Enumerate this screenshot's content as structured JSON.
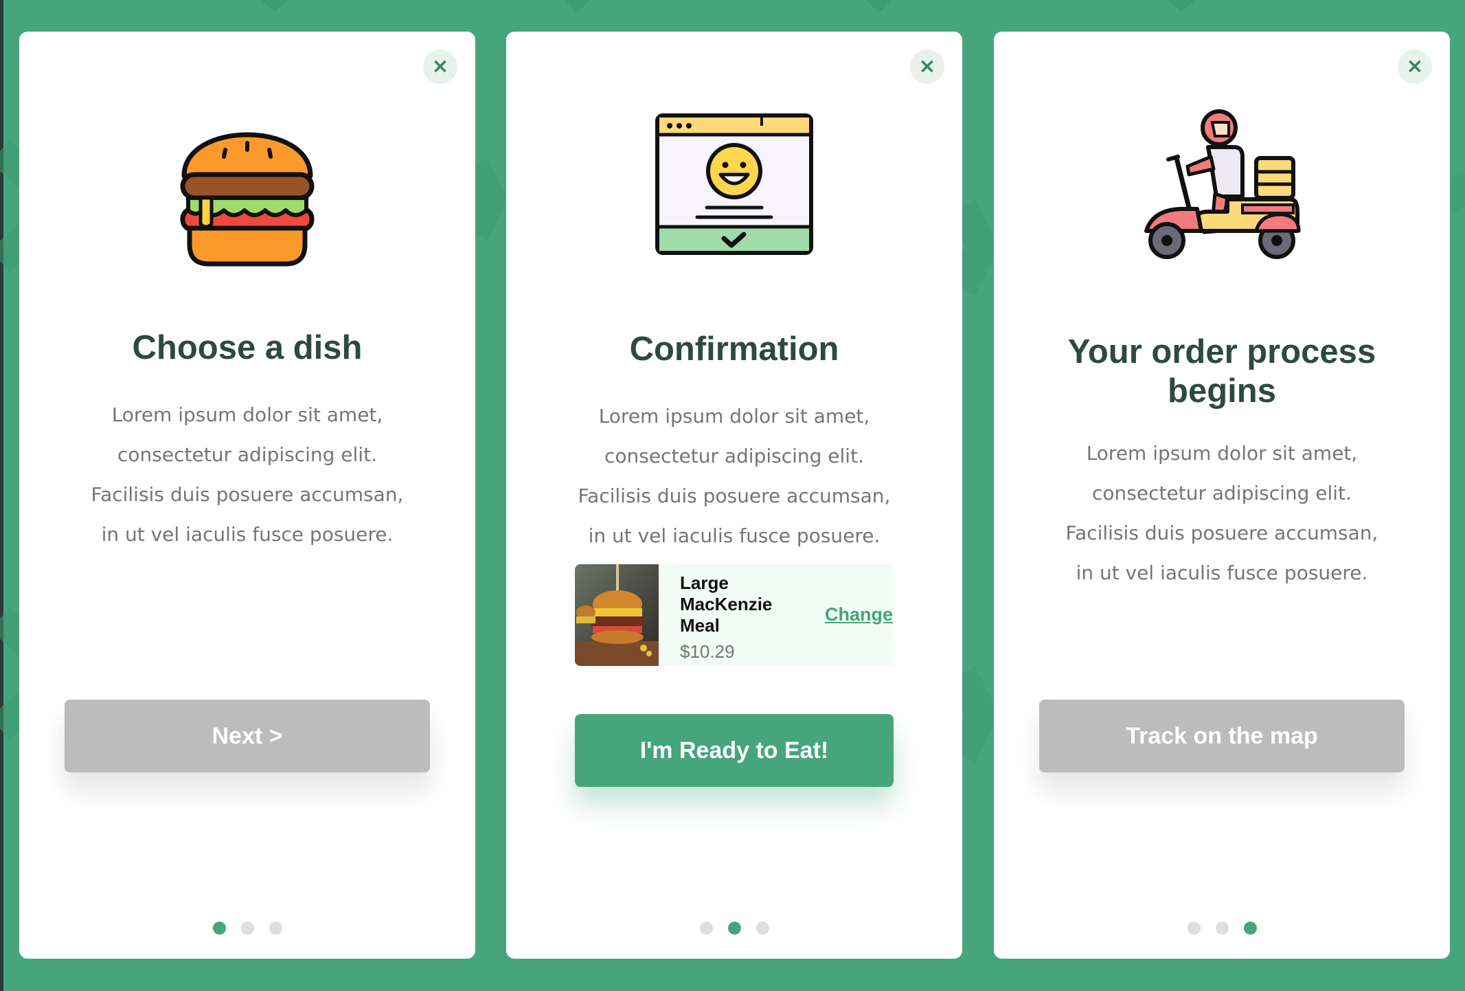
{
  "theme": {
    "background": "#46a57b",
    "accent": "#46a57b",
    "button_inactive": "#bcbcbc",
    "title_color": "#2d4a3e"
  },
  "cards": [
    {
      "icon": "burger-icon",
      "title": "Choose a dish",
      "description": [
        "Lorem ipsum dolor sit amet,",
        "consectetur adipiscing elit.",
        "Facilisis duis posuere accumsan,",
        "in ut vel iaculis fusce posuere."
      ],
      "button_label": "Next >",
      "close_glyph": "×",
      "active_dot": 1
    },
    {
      "icon": "confirmation-icon",
      "title": "Confirmation",
      "description": [
        "Lorem ipsum dolor sit amet,",
        "consectetur adipiscing elit.",
        "Facilisis duis posuere accumsan,",
        "in ut vel iaculis fusce posuere."
      ],
      "order": {
        "name": "Large MacKenzie Meal",
        "price": "$10.29",
        "change_label": "Change",
        "photo_icon": "burger-photo"
      },
      "button_label": "I'm Ready to Eat!",
      "close_glyph": "×",
      "active_dot": 2
    },
    {
      "icon": "delivery-scooter-icon",
      "title": "Your order process begins",
      "description": [
        "Lorem ipsum dolor sit amet,",
        "consectetur adipiscing elit.",
        "Facilisis duis posuere accumsan,",
        "in ut vel iaculis fusce posuere."
      ],
      "button_label": "Track on the map",
      "close_glyph": "×",
      "active_dot": 3
    }
  ]
}
